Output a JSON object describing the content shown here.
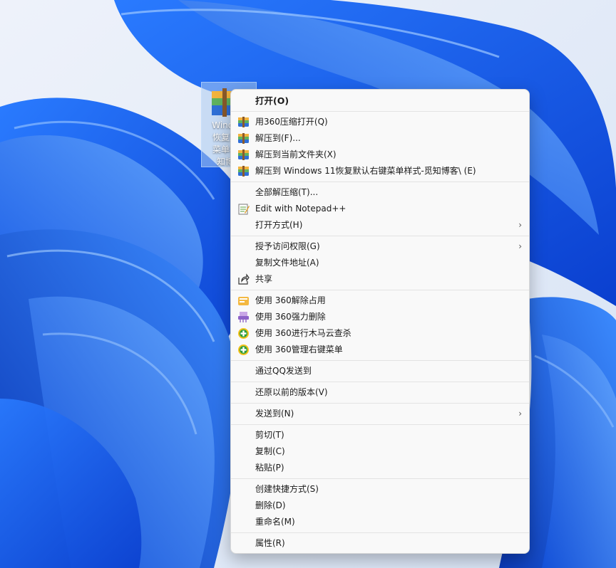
{
  "desktop": {
    "file_label": "Windo…\n恢复默…\n菜单样…\n知博客"
  },
  "menu": {
    "groups": [
      [
        {
          "label": "打开(O)",
          "icon": "none",
          "bold": true
        }
      ],
      [
        {
          "label": "用360压缩打开(Q)",
          "icon": "archive-icon"
        },
        {
          "label": "解压到(F)...",
          "icon": "archive-icon"
        },
        {
          "label": "解压到当前文件夹(X)",
          "icon": "archive-icon"
        },
        {
          "label": "解压到 Windows 11恢复默认右键菜单样式-觅知博客\\ (E)",
          "icon": "archive-icon"
        }
      ],
      [
        {
          "label": "全部解压缩(T)...",
          "icon": "none"
        },
        {
          "label": "Edit with Notepad++",
          "icon": "notepad-icon"
        },
        {
          "label": "打开方式(H)",
          "icon": "none",
          "submenu": true
        }
      ],
      [
        {
          "label": "授予访问权限(G)",
          "icon": "none",
          "submenu": true
        },
        {
          "label": "复制文件地址(A)",
          "icon": "none"
        },
        {
          "label": "共享",
          "icon": "share-icon"
        }
      ],
      [
        {
          "label": "使用 360解除占用",
          "icon": "unlock-icon"
        },
        {
          "label": "使用 360强力删除",
          "icon": "shredder-icon"
        },
        {
          "label": "使用 360进行木马云查杀",
          "icon": "shield-plus-icon"
        },
        {
          "label": "使用 360管理右键菜单",
          "icon": "shield-plus-icon"
        }
      ],
      [
        {
          "label": "通过QQ发送到",
          "icon": "none"
        }
      ],
      [
        {
          "label": "还原以前的版本(V)",
          "icon": "none"
        }
      ],
      [
        {
          "label": "发送到(N)",
          "icon": "none",
          "submenu": true
        }
      ],
      [
        {
          "label": "剪切(T)",
          "icon": "none"
        },
        {
          "label": "复制(C)",
          "icon": "none"
        },
        {
          "label": "粘贴(P)",
          "icon": "none"
        }
      ],
      [
        {
          "label": "创建快捷方式(S)",
          "icon": "none"
        },
        {
          "label": "删除(D)",
          "icon": "none"
        },
        {
          "label": "重命名(M)",
          "icon": "none"
        }
      ],
      [
        {
          "label": "属性(R)",
          "icon": "none"
        }
      ]
    ],
    "submenu_arrow": "›"
  },
  "colors": {
    "wallpaper_base": "#1a5fe0",
    "wallpaper_light": "#5aa0ff",
    "menu_bg": "#f9f9f9"
  }
}
